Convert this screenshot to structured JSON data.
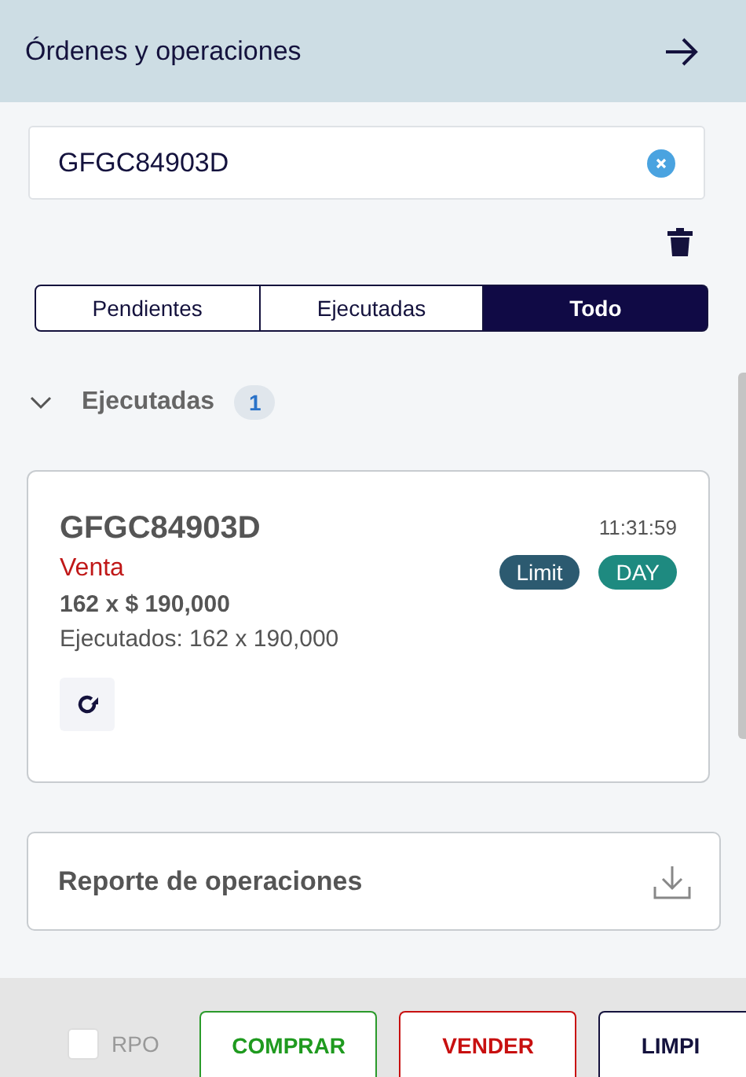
{
  "header": {
    "title": "Órdenes y operaciones"
  },
  "search": {
    "value": "GFGC84903D"
  },
  "tabs": [
    {
      "label": "Pendientes",
      "selected": false
    },
    {
      "label": "Ejecutadas",
      "selected": false
    },
    {
      "label": "Todo",
      "selected": true
    }
  ],
  "section": {
    "title": "Ejecutadas",
    "count": "1",
    "expanded": true
  },
  "order": {
    "symbol": "GFGC84903D",
    "side": "Venta",
    "time": "11:31:59",
    "tags": [
      {
        "label": "Limit",
        "color": "#2c5a70"
      },
      {
        "label": "DAY",
        "color": "#1e8a80"
      }
    ],
    "quantity_price": "162 x $ 190,000",
    "executed": "Ejecutados: 162 x 190,000"
  },
  "report": {
    "title": "Reporte de operaciones"
  },
  "footer": {
    "rpo": {
      "label": "RPO",
      "checked": false
    },
    "buttons": [
      {
        "label": "COMPRAR",
        "kind": "buy"
      },
      {
        "label": "VENDER",
        "kind": "sell"
      },
      {
        "label": "LIMPI",
        "kind": "clear"
      }
    ]
  }
}
